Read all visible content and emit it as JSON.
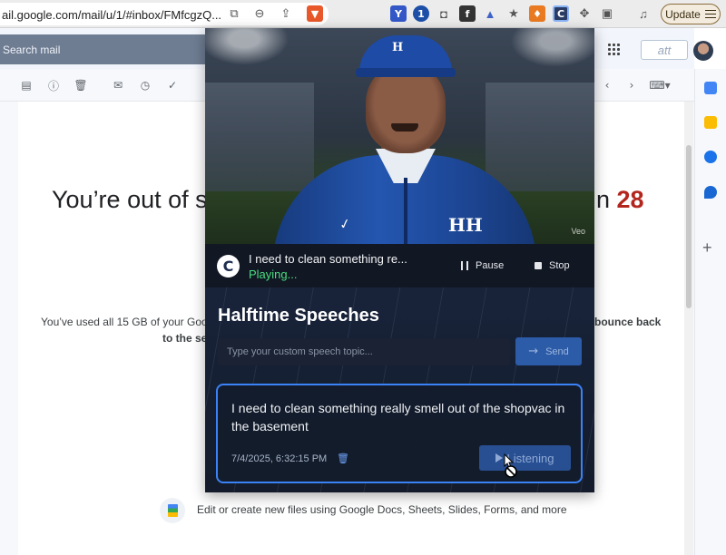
{
  "browser": {
    "url": "ail.google.com/mail/u/1/#inbox/FMfcgzQ...",
    "update_label": "Update",
    "extension_c_label": "C"
  },
  "gmail": {
    "search_placeholder": "Search mail",
    "logo_text": "att",
    "storage_title_left": "You’re out of st",
    "storage_title_right_prefix": "n ",
    "storage_title_right_days": "28",
    "storage_body_left": "You’ve used all 15 GB of your Google",
    "storage_body_left_line2": "to the se",
    "storage_body_right": "bounce back",
    "docs_text": "Edit or create new files using Google Docs, Sheets, Slides, Forms, and more"
  },
  "popup": {
    "video": {
      "cap_logo": "H",
      "jacket_logo": "HH",
      "watermark": "Veo"
    },
    "player": {
      "logo_letter": "C",
      "now_playing_title": "I need to clean something re...",
      "status": "Playing...",
      "pause_label": "Pause",
      "stop_label": "Stop"
    },
    "heading": "Halftime Speeches",
    "topic_input": {
      "placeholder": "Type your custom speech topic...",
      "value": ""
    },
    "send_label": "Send",
    "speech_card": {
      "text": "I need to clean something really smell out of the shopvac in the basement",
      "timestamp": "7/4/2025, 6:32:15 PM",
      "listen_label": "Listening"
    }
  },
  "colors": {
    "accent_blue": "#3b82f6",
    "playing_green": "#4ade80",
    "days_red": "#b3261e"
  }
}
